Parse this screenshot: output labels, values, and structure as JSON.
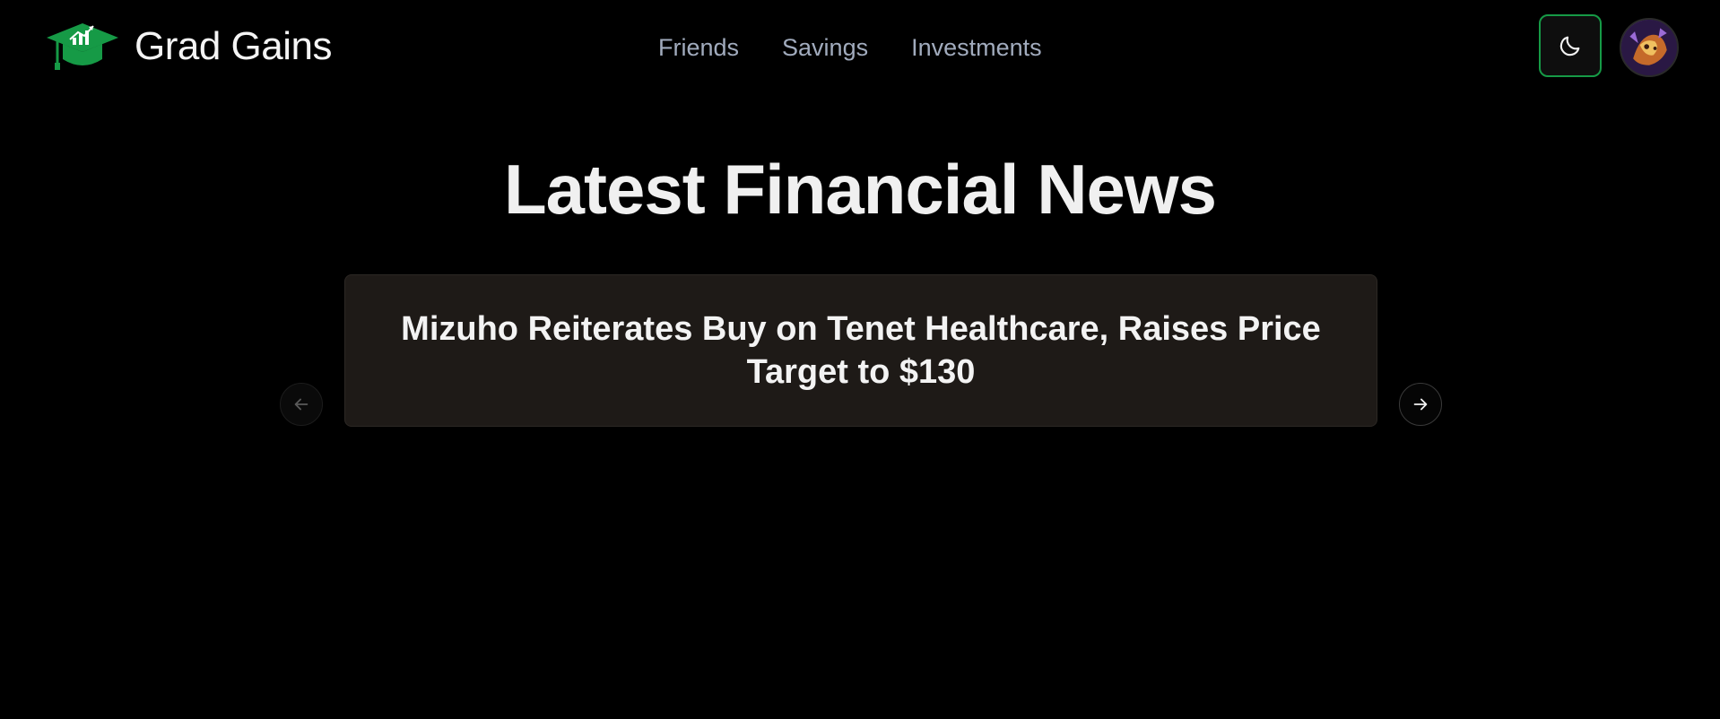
{
  "app": {
    "name": "Grad Gains"
  },
  "nav": {
    "items": [
      {
        "label": "Friends"
      },
      {
        "label": "Savings"
      },
      {
        "label": "Investments"
      }
    ]
  },
  "header": {
    "theme_toggle_icon": "moon-icon",
    "avatar_icon": "user-avatar"
  },
  "main": {
    "title": "Latest Financial News",
    "news": {
      "headline": "Mizuho Reiterates Buy on Tenet Healthcare, Raises Price Target to $130"
    }
  },
  "carousel": {
    "prev_icon": "arrow-left-icon",
    "next_icon": "arrow-right-icon"
  },
  "colors": {
    "accent": "#169a46",
    "background": "#000000",
    "card": "#1e1a17",
    "nav_text": "#a1abbd"
  }
}
